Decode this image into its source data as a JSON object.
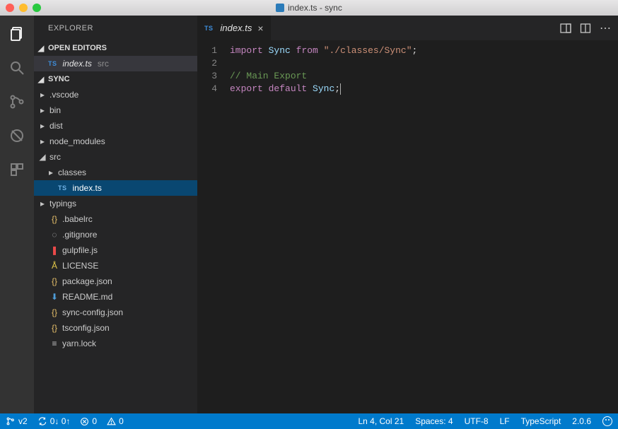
{
  "window": {
    "title": "index.ts - sync"
  },
  "activitybar": [
    {
      "id": "explorer",
      "active": true
    },
    {
      "id": "search"
    },
    {
      "id": "git"
    },
    {
      "id": "debug"
    },
    {
      "id": "extensions"
    }
  ],
  "sidebar": {
    "title": "EXPLORER",
    "openEditors": {
      "label": "OPEN EDITORS",
      "items": [
        {
          "icon": "TS",
          "name": "index.ts",
          "path": "src",
          "active": true
        }
      ]
    },
    "workspace": {
      "label": "SYNC",
      "tree": [
        {
          "depth": 0,
          "kind": "folder",
          "collapsed": true,
          "name": ".vscode"
        },
        {
          "depth": 0,
          "kind": "folder",
          "collapsed": true,
          "name": "bin"
        },
        {
          "depth": 0,
          "kind": "folder",
          "collapsed": true,
          "name": "dist"
        },
        {
          "depth": 0,
          "kind": "folder",
          "collapsed": true,
          "name": "node_modules"
        },
        {
          "depth": 0,
          "kind": "folder",
          "collapsed": false,
          "name": "src"
        },
        {
          "depth": 1,
          "kind": "folder",
          "collapsed": true,
          "name": "classes"
        },
        {
          "depth": 1,
          "kind": "file",
          "icon": "TS",
          "name": "index.ts",
          "selected": true
        },
        {
          "depth": 0,
          "kind": "folder",
          "collapsed": true,
          "name": "typings"
        },
        {
          "depth": 0,
          "kind": "file",
          "icon": "braces",
          "iconColor": "#e8c16a",
          "name": ".babelrc"
        },
        {
          "depth": 0,
          "kind": "file",
          "icon": "github",
          "iconColor": "#bfbfbf",
          "name": ".gitignore"
        },
        {
          "depth": 0,
          "kind": "file",
          "icon": "gulp",
          "iconColor": "#eb4a4a",
          "name": "gulpfile.js"
        },
        {
          "depth": 0,
          "kind": "file",
          "icon": "license",
          "iconColor": "#e3c84a",
          "name": "LICENSE"
        },
        {
          "depth": 0,
          "kind": "file",
          "icon": "braces",
          "iconColor": "#e8c16a",
          "name": "package.json"
        },
        {
          "depth": 0,
          "kind": "file",
          "icon": "readme",
          "iconColor": "#4e9dd8",
          "name": "README.md"
        },
        {
          "depth": 0,
          "kind": "file",
          "icon": "braces",
          "iconColor": "#e8c16a",
          "name": "sync-config.json"
        },
        {
          "depth": 0,
          "kind": "file",
          "icon": "braces",
          "iconColor": "#e8c16a",
          "name": "tsconfig.json"
        },
        {
          "depth": 0,
          "kind": "file",
          "icon": "lines",
          "iconColor": "#bfbfbf",
          "name": "yarn.lock"
        }
      ]
    }
  },
  "tabs": {
    "open": [
      {
        "icon": "TS",
        "name": "index.ts",
        "active": true
      }
    ]
  },
  "editor": {
    "lines": [
      [
        {
          "c": "tok-keyword",
          "t": "import"
        },
        {
          "t": " "
        },
        {
          "c": "tok-var",
          "t": "Sync"
        },
        {
          "t": " "
        },
        {
          "c": "tok-keyword",
          "t": "from"
        },
        {
          "t": " "
        },
        {
          "c": "tok-string",
          "t": "\"./classes/Sync\""
        },
        {
          "t": ";"
        }
      ],
      [],
      [
        {
          "c": "tok-comment",
          "t": "// Main Export"
        }
      ],
      [
        {
          "c": "tok-keyword",
          "t": "export"
        },
        {
          "t": " "
        },
        {
          "c": "tok-keyword",
          "t": "default"
        },
        {
          "t": " "
        },
        {
          "c": "tok-var",
          "t": "Sync"
        },
        {
          "t": ";",
          "caret": true
        }
      ]
    ]
  },
  "statusbar": {
    "left": {
      "version": "v2",
      "gitSync": "0↓ 0↑",
      "errors": "0",
      "warnings": "0"
    },
    "right": {
      "lncol": "Ln 4, Col 21",
      "spaces": "Spaces: 4",
      "encoding": "UTF-8",
      "eol": "LF",
      "lang": "TypeScript",
      "extver": "2.0.6"
    }
  }
}
